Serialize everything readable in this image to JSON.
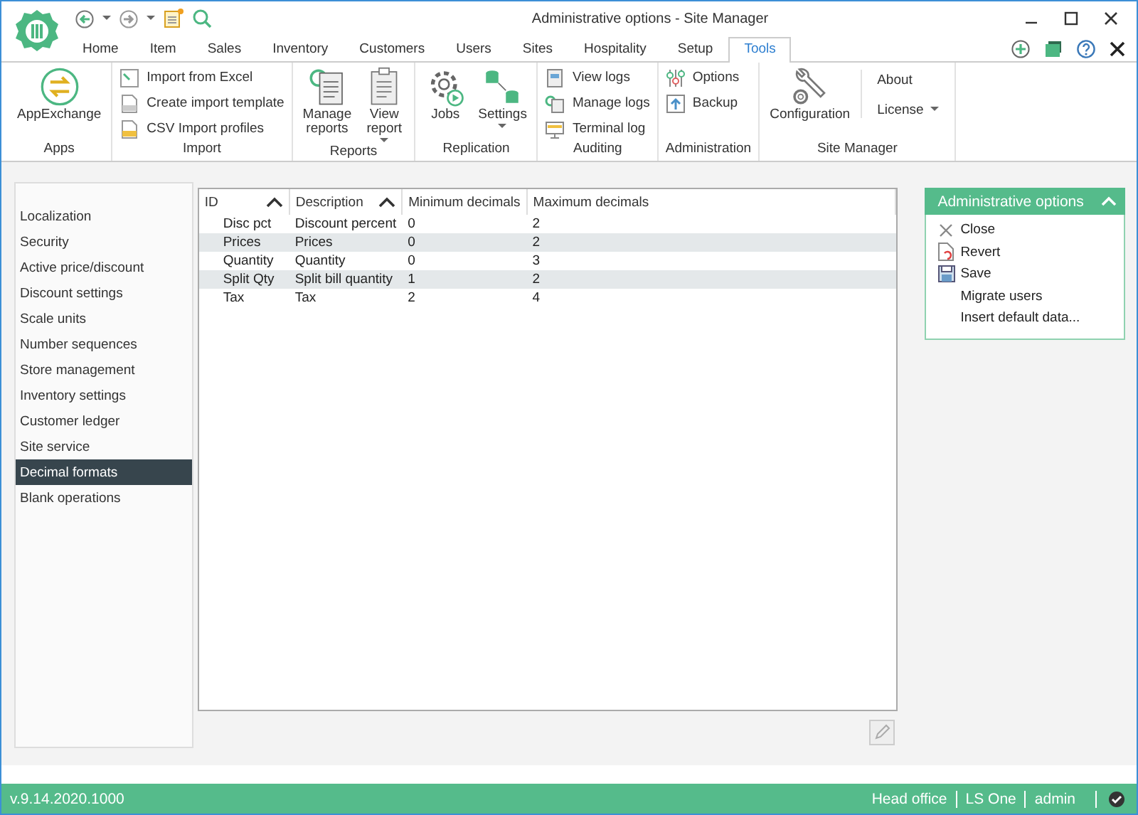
{
  "window": {
    "title": "Administrative options - Site Manager"
  },
  "tabs": [
    {
      "label": "Home",
      "selected": false
    },
    {
      "label": "Item",
      "selected": false
    },
    {
      "label": "Sales",
      "selected": false
    },
    {
      "label": "Inventory",
      "selected": false
    },
    {
      "label": "Customers",
      "selected": false
    },
    {
      "label": "Users",
      "selected": false
    },
    {
      "label": "Sites",
      "selected": false
    },
    {
      "label": "Hospitality",
      "selected": false
    },
    {
      "label": "Setup",
      "selected": false
    },
    {
      "label": "Tools",
      "selected": true
    }
  ],
  "ribbon": {
    "groups": [
      {
        "label": "Apps",
        "items": [
          {
            "label": "AppExchange",
            "kind": "large",
            "dropdown": false
          }
        ]
      },
      {
        "label": "Import",
        "items": [
          {
            "label": "Import from Excel",
            "kind": "small",
            "dropdown": false
          },
          {
            "label": "Create import template",
            "kind": "small",
            "dropdown": false
          },
          {
            "label": "CSV Import profiles",
            "kind": "small",
            "dropdown": false
          }
        ]
      },
      {
        "label": "Reports",
        "items": [
          {
            "label": "Manage reports",
            "kind": "large",
            "dropdown": false
          },
          {
            "label": "View report",
            "kind": "large",
            "dropdown": true
          }
        ]
      },
      {
        "label": "Replication",
        "items": [
          {
            "label": "Jobs",
            "kind": "large",
            "dropdown": false
          },
          {
            "label": "Settings",
            "kind": "large",
            "dropdown": true
          }
        ]
      },
      {
        "label": "Auditing",
        "items": [
          {
            "label": "View logs",
            "kind": "small",
            "dropdown": false
          },
          {
            "label": "Manage logs",
            "kind": "small",
            "dropdown": false
          },
          {
            "label": "Terminal log",
            "kind": "small",
            "dropdown": false
          }
        ]
      },
      {
        "label": "Administration",
        "items": [
          {
            "label": "Options",
            "kind": "small",
            "dropdown": false
          },
          {
            "label": "Backup",
            "kind": "small",
            "dropdown": false
          }
        ]
      },
      {
        "label": "Site Manager",
        "items": [
          {
            "label": "Configuration",
            "kind": "large",
            "dropdown": false
          },
          {
            "label": "About",
            "kind": "text",
            "dropdown": false
          },
          {
            "label": "License",
            "kind": "text",
            "dropdown": true
          }
        ]
      }
    ]
  },
  "sidebar": {
    "items": [
      {
        "label": "Localization",
        "selected": false
      },
      {
        "label": "Security",
        "selected": false
      },
      {
        "label": "Active price/discount",
        "selected": false
      },
      {
        "label": "Discount settings",
        "selected": false
      },
      {
        "label": "Scale units",
        "selected": false
      },
      {
        "label": "Number sequences",
        "selected": false
      },
      {
        "label": "Store management",
        "selected": false
      },
      {
        "label": "Inventory settings",
        "selected": false
      },
      {
        "label": "Customer ledger",
        "selected": false
      },
      {
        "label": "Site service",
        "selected": false
      },
      {
        "label": "Decimal formats",
        "selected": true
      },
      {
        "label": "Blank operations",
        "selected": false
      }
    ]
  },
  "table": {
    "columns": [
      {
        "label": "ID",
        "sorted": true
      },
      {
        "label": "Description",
        "sorted": true
      },
      {
        "label": "Minimum decimals",
        "sorted": false
      },
      {
        "label": "Maximum decimals",
        "sorted": false
      }
    ],
    "rows": [
      [
        "Disc pct",
        "Discount percent",
        "0",
        "2"
      ],
      [
        "Prices",
        "Prices",
        "0",
        "2"
      ],
      [
        "Quantity",
        "Quantity",
        "0",
        "3"
      ],
      [
        "Split Qty",
        "Split bill quantity",
        "1",
        "2"
      ],
      [
        "Tax",
        "Tax",
        "2",
        "4"
      ]
    ]
  },
  "task_panel": {
    "title": "Administrative options",
    "expanded": true,
    "items": [
      {
        "label": "Close"
      },
      {
        "label": "Revert"
      },
      {
        "label": "Save"
      },
      {
        "label": "Migrate users"
      },
      {
        "label": "Insert default data..."
      }
    ]
  },
  "status_bar": {
    "version": "v.9.14.2020.1000",
    "segments": [
      "Head office",
      "LS One",
      "admin"
    ]
  }
}
